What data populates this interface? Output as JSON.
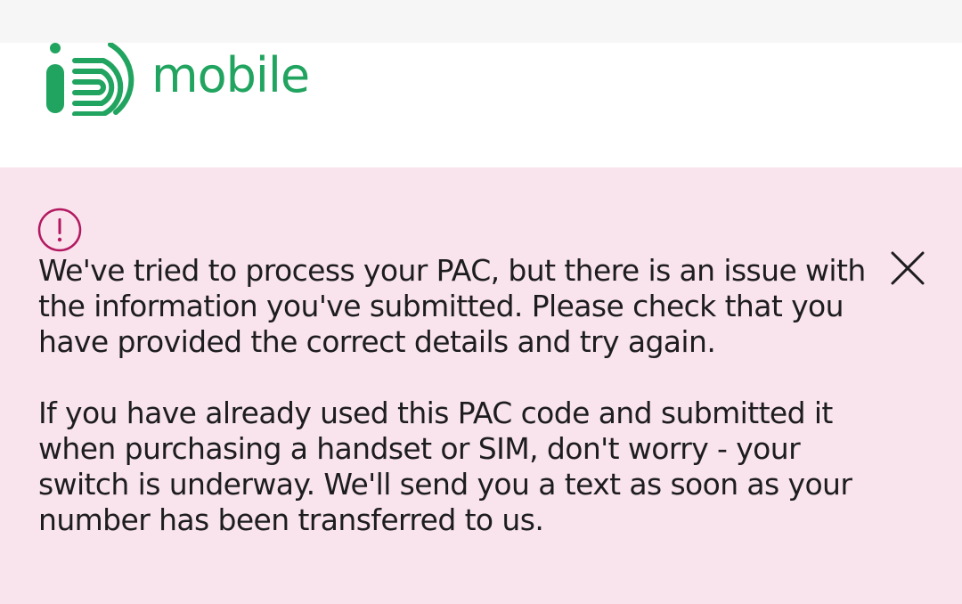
{
  "brand": {
    "name": "mobile",
    "logo_icon": "id-mobile-logo-icon",
    "color": "#21a45f"
  },
  "alert": {
    "icon": "exclamation-circle-icon",
    "close_icon": "close-icon",
    "accent_color": "#b21860",
    "background": "#f9e3ec",
    "paragraph_1": "We've tried to process your PAC, but there is an issue with the information you've submitted. Please check that you have provided the correct details and try again.",
    "paragraph_2": "If you have already used this PAC code and submitted it when purchasing a handset or SIM, don't worry - your switch is underway. We'll send you a text as soon as your number has been transferred to us."
  }
}
